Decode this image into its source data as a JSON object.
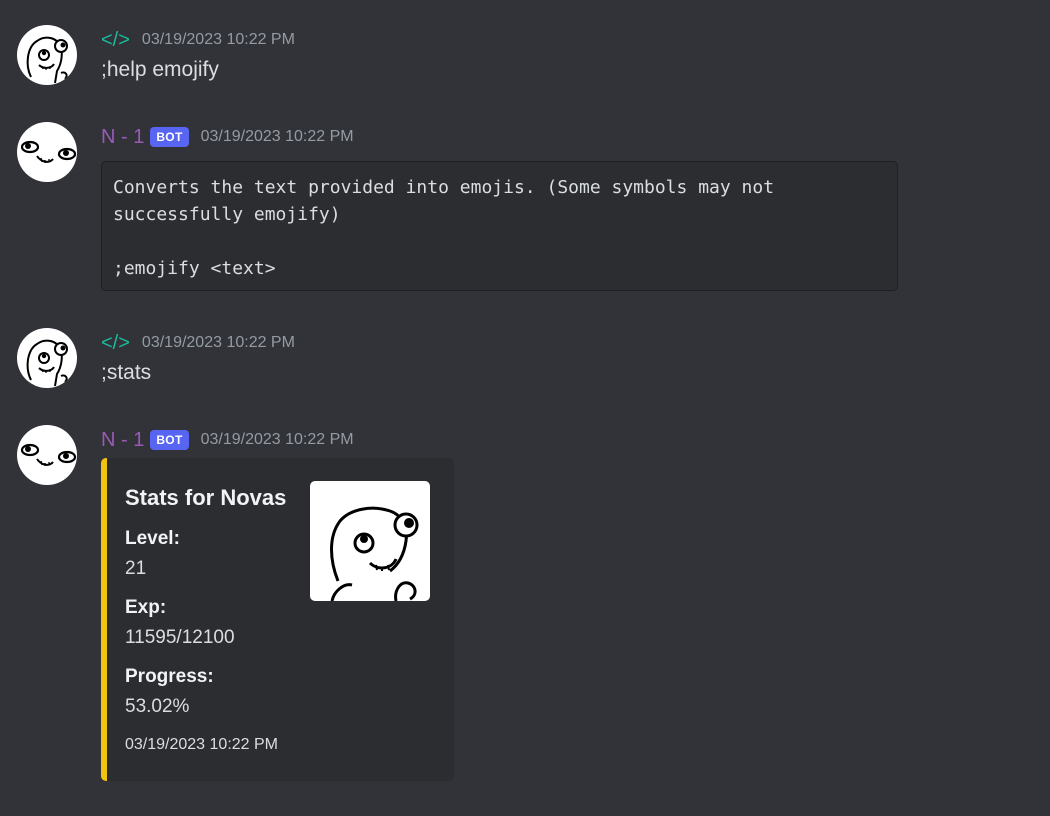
{
  "messages": [
    {
      "author": "</>",
      "author_color": "#1abc9c",
      "timestamp": "03/19/2023 10:22 PM",
      "text": ";help emojify",
      "avatar_icon": "cartoon-face-avatar"
    },
    {
      "author": "N - 1",
      "author_color": "#9b59b6",
      "bot_tag": "BOT",
      "timestamp": "03/19/2023 10:22 PM",
      "code": "Converts the text provided into emojis. (Some symbols may not\nsuccessfully emojify)\n\n;emojify <text>",
      "avatar_icon": "smirk-face-avatar"
    },
    {
      "author": "</>",
      "author_color": "#1abc9c",
      "timestamp": "03/19/2023 10:22 PM",
      "text": ";stats",
      "avatar_icon": "cartoon-face-avatar"
    },
    {
      "author": "N - 1",
      "author_color": "#9b59b6",
      "bot_tag": "BOT",
      "timestamp": "03/19/2023 10:22 PM",
      "avatar_icon": "smirk-face-avatar",
      "embed": {
        "accent_color": "#f1c40f",
        "title": "Stats for Novas",
        "fields": [
          {
            "name": "Level:",
            "value": "21"
          },
          {
            "name": "Exp:",
            "value": "11595/12100"
          },
          {
            "name": "Progress:",
            "value": "53.02%"
          }
        ],
        "footer": "03/19/2023 10:22 PM",
        "thumbnail_icon": "cartoon-character-thumbnail"
      }
    }
  ]
}
